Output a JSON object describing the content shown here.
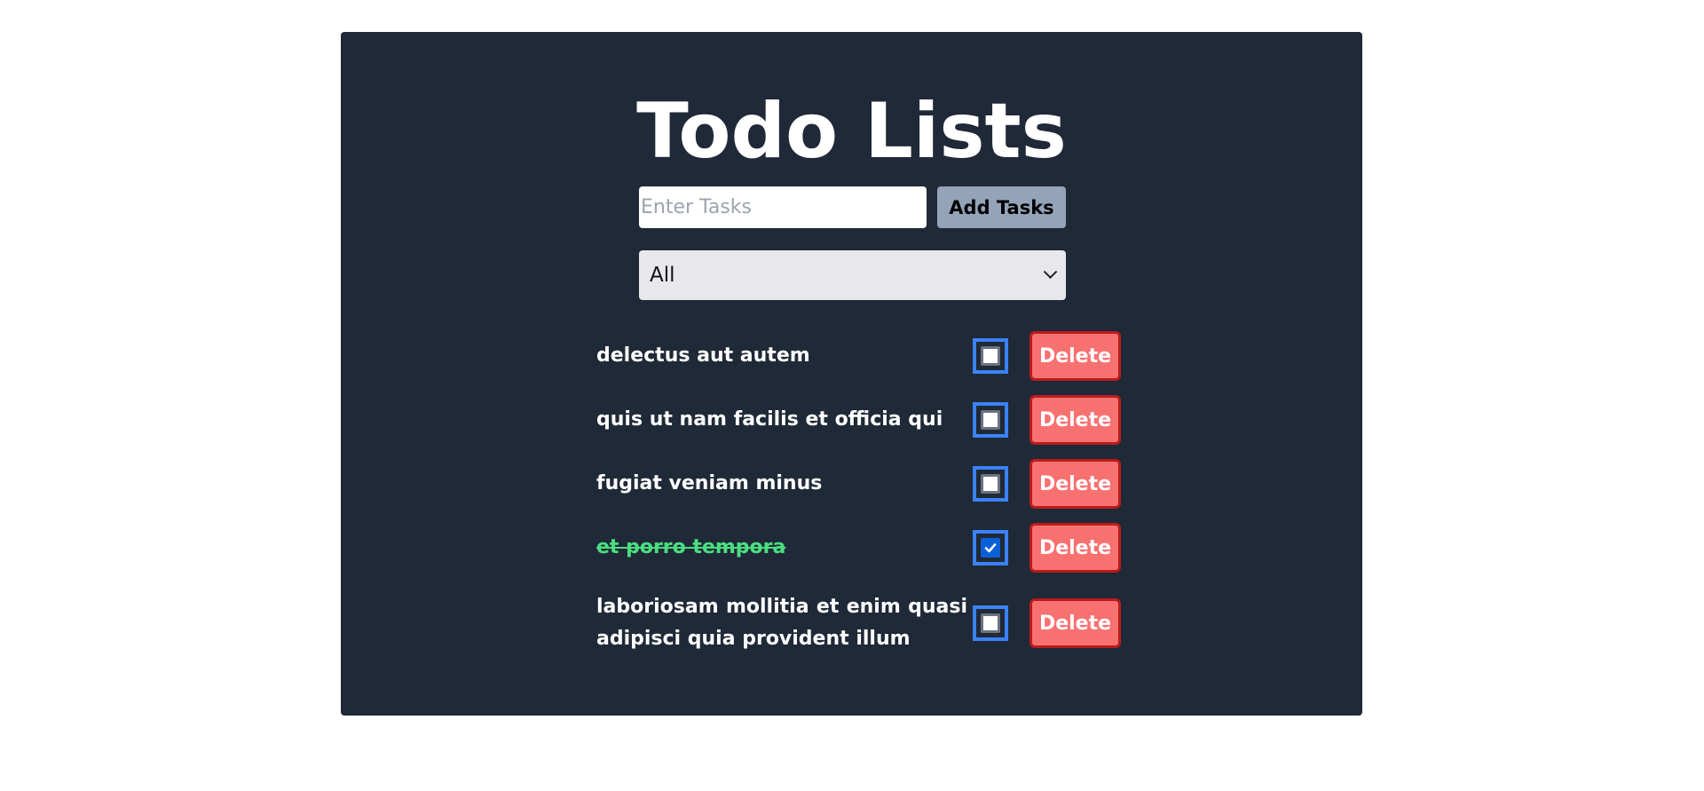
{
  "header": {
    "title": "Todo Lists"
  },
  "form": {
    "placeholder": "Enter Tasks",
    "value": "",
    "add_label": "Add Tasks"
  },
  "filter": {
    "selected": "All"
  },
  "todos": [
    {
      "text": "delectus aut autem",
      "done": false,
      "delete_label": "Delete"
    },
    {
      "text": "quis ut nam facilis et officia qui",
      "done": false,
      "delete_label": "Delete"
    },
    {
      "text": "fugiat veniam minus",
      "done": false,
      "delete_label": "Delete"
    },
    {
      "text": "et porro tempora",
      "done": true,
      "delete_label": "Delete"
    },
    {
      "text": "laboriosam mollitia et enim quasi adipisci quia provident illum",
      "done": false,
      "delete_label": "Delete"
    }
  ],
  "colors": {
    "panel": "#1f2937",
    "done_text": "#4ade80",
    "delete_bg": "#f87171",
    "checkbox_border": "#3b82f6"
  }
}
